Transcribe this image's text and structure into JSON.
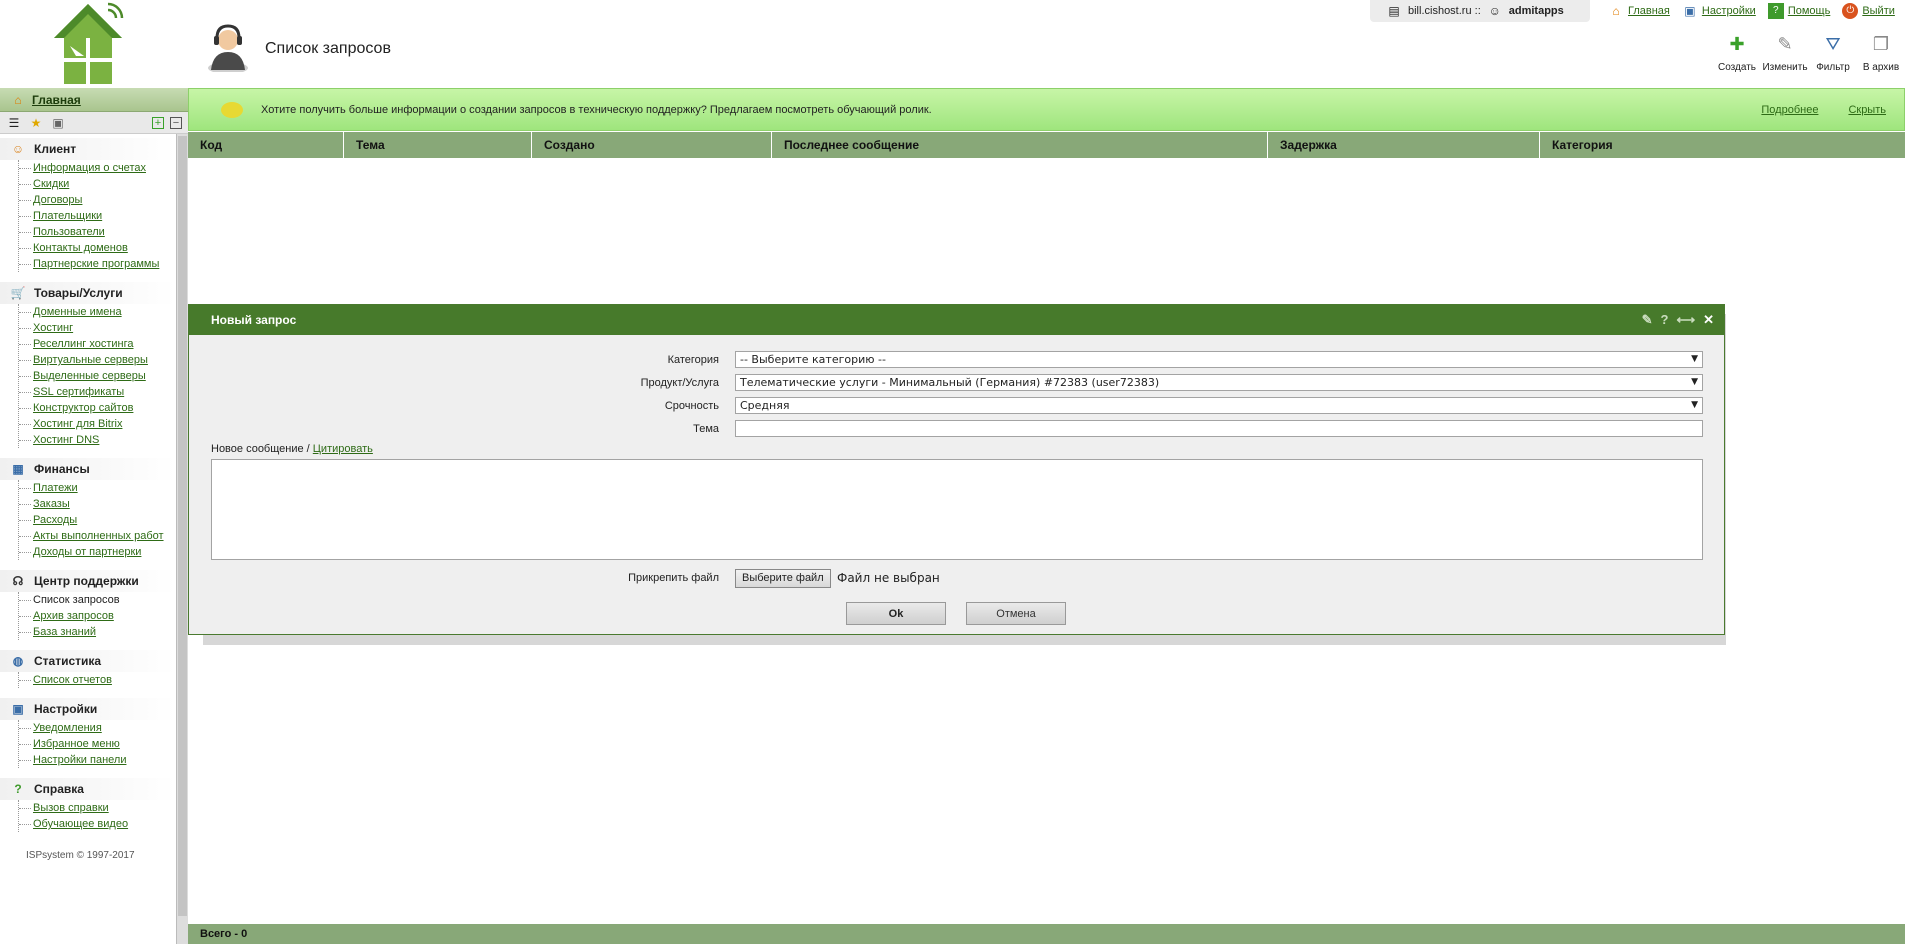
{
  "header": {
    "page_title": "Список запросов",
    "host": "bill.cishost.ru ::",
    "user": "admitapps",
    "top_links": [
      "Главная",
      "Настройки",
      "Помощь",
      "Выйти"
    ],
    "toolbar": [
      "Создать",
      "Изменить",
      "Фильтр",
      "В архив"
    ]
  },
  "sidebar": {
    "home": "Главная",
    "sections": [
      {
        "title": "Клиент",
        "icon": "client-icon",
        "items": [
          "Информация о счетах",
          "Скидки",
          "Договоры",
          "Плательщики",
          "Пользователи",
          "Контакты доменов",
          "Партнерские программы"
        ]
      },
      {
        "title": "Товары/Услуги",
        "icon": "cart-icon",
        "items": [
          "Доменные имена",
          "Хостинг",
          "Реселлинг хостинга",
          "Виртуальные серверы",
          "Выделенные серверы",
          "SSL сертификаты",
          "Конструктор сайтов",
          "Хостинг для Bitrix",
          "Хостинг DNS"
        ]
      },
      {
        "title": "Финансы",
        "icon": "finance-icon",
        "items": [
          "Платежи",
          "Заказы",
          "Расходы",
          "Акты выполненных работ",
          "Доходы от партнерки"
        ]
      },
      {
        "title": "Центр поддержки",
        "icon": "headset-icon",
        "items": [
          "Список запросов",
          "Архив запросов",
          "База знаний"
        ]
      },
      {
        "title": "Статистика",
        "icon": "globe-icon",
        "items": [
          "Список отчетов"
        ]
      },
      {
        "title": "Настройки",
        "icon": "settings-icon",
        "items": [
          "Уведомления",
          "Избранное меню",
          "Настройки панели"
        ]
      },
      {
        "title": "Справка",
        "icon": "help-icon",
        "items": [
          "Вызов справки",
          "Обучающее видео"
        ]
      }
    ],
    "copyright": "ISPsystem © 1997-2017"
  },
  "info_bar": {
    "message": "Хотите получить больше информации о создании запросов в техническую поддержку? Предлагаем посмотреть обучающий ролик.",
    "more": "Подробнее",
    "hide": "Скрыть"
  },
  "grid": {
    "columns": [
      "Код",
      "Тема",
      "Создано",
      "Последнее сообщение",
      "Задержка",
      "Категория"
    ],
    "total": "Всего - 0"
  },
  "dialog": {
    "title": "Новый запрос",
    "category_label": "Категория",
    "category_value": "-- Выберите категорию --",
    "product_label": "Продукт/Услуга",
    "product_value": "Телематические услуги - Минимальный (Германия) #72383 (user72383)",
    "urgency_label": "Срочность",
    "urgency_value": "Средняя",
    "subject_label": "Тема",
    "subject_value": "",
    "message_label": "Новое сообщение /",
    "quote_link": "Цитировать",
    "attach_label": "Прикрепить файл",
    "choose_file": "Выберите файл",
    "no_file": "Файл не выбран",
    "ok": "Ok",
    "cancel": "Отмена"
  }
}
